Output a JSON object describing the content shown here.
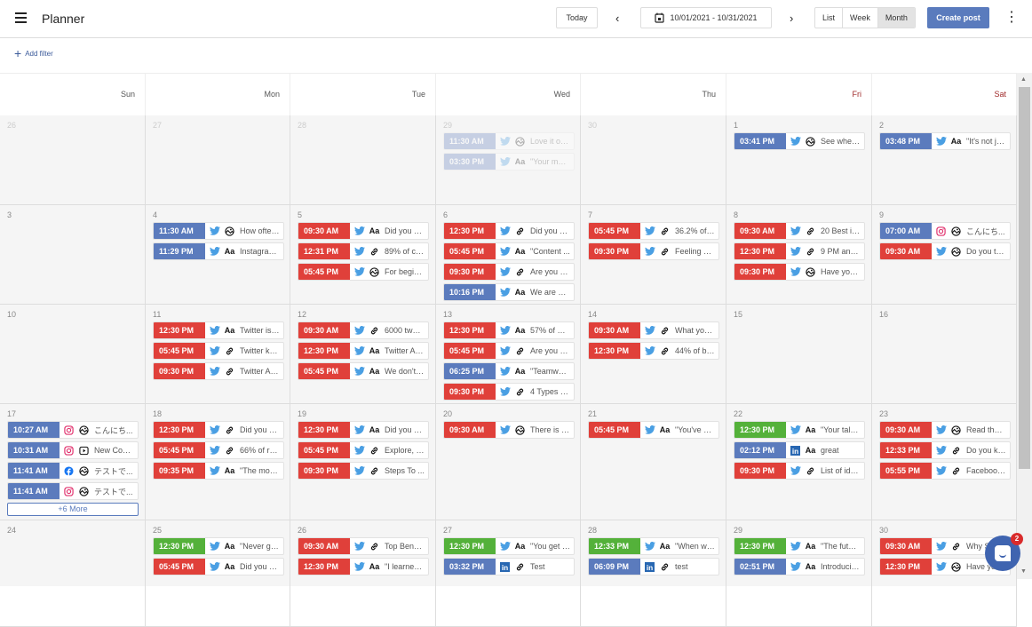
{
  "header": {
    "title": "Planner",
    "today_label": "Today",
    "prev_icon": "chevron-left",
    "next_icon": "chevron-right",
    "date_range": "10/01/2021 - 10/31/2021",
    "views": [
      "List",
      "Week",
      "Month"
    ],
    "active_view": "Month",
    "create_label": "Create post",
    "more_icon": "kebab-vertical"
  },
  "filter": {
    "label": "Add filter"
  },
  "weekdays": [
    "Sun",
    "Mon",
    "Tue",
    "Wed",
    "Thu",
    "Fri",
    "Sat"
  ],
  "colors": {
    "published": "#5b7bbd",
    "failed": "#e0403a",
    "scheduled": "#54b13a"
  },
  "weeks": [
    [
      {
        "day": "26",
        "other": true,
        "posts": []
      },
      {
        "day": "27",
        "other": true,
        "posts": []
      },
      {
        "day": "28",
        "other": true,
        "posts": []
      },
      {
        "day": "29",
        "other": true,
        "posts": [
          {
            "time": "11:30 AM",
            "status": "published",
            "network": "twitter",
            "type": "image",
            "text": "Love it or ..."
          },
          {
            "time": "03:30 PM",
            "status": "published",
            "network": "twitter",
            "type": "text",
            "text": "\"Your mar..."
          }
        ]
      },
      {
        "day": "30",
        "other": true,
        "posts": []
      },
      {
        "day": "1",
        "posts": [
          {
            "time": "03:41 PM",
            "status": "published",
            "network": "twitter",
            "type": "image",
            "text": "See where ..."
          }
        ]
      },
      {
        "day": "2",
        "posts": [
          {
            "time": "03:48 PM",
            "status": "published",
            "network": "twitter",
            "type": "text",
            "text": "\"It's not ju..."
          }
        ]
      }
    ],
    [
      {
        "day": "3",
        "posts": []
      },
      {
        "day": "4",
        "posts": [
          {
            "time": "11:30 AM",
            "status": "published",
            "network": "twitter",
            "type": "image",
            "text": "How often..."
          },
          {
            "time": "11:29 PM",
            "status": "published",
            "network": "twitter",
            "type": "text",
            "text": "Instagram ..."
          }
        ]
      },
      {
        "day": "5",
        "posts": [
          {
            "time": "09:30 AM",
            "status": "failed",
            "network": "twitter",
            "type": "text",
            "text": "Did you kn..."
          },
          {
            "time": "12:31 PM",
            "status": "failed",
            "network": "twitter",
            "type": "link",
            "text": "89% of co..."
          },
          {
            "time": "05:45 PM",
            "status": "failed",
            "network": "twitter",
            "type": "image",
            "text": "For beginn..."
          }
        ]
      },
      {
        "day": "6",
        "posts": [
          {
            "time": "12:30 PM",
            "status": "failed",
            "network": "twitter",
            "type": "link",
            "text": "Did you kn..."
          },
          {
            "time": "05:45 PM",
            "status": "failed",
            "network": "twitter",
            "type": "text",
            "text": "\"Content ..."
          },
          {
            "time": "09:30 PM",
            "status": "failed",
            "network": "twitter",
            "type": "link",
            "text": "Are you str..."
          },
          {
            "time": "10:16 PM",
            "status": "published",
            "network": "twitter",
            "type": "text",
            "text": "We are ho..."
          }
        ]
      },
      {
        "day": "7",
        "posts": [
          {
            "time": "05:45 PM",
            "status": "failed",
            "network": "twitter",
            "type": "link",
            "text": "36.2% of B..."
          },
          {
            "time": "09:30 PM",
            "status": "failed",
            "network": "twitter",
            "type": "link",
            "text": "Feeling stu..."
          }
        ]
      },
      {
        "day": "8",
        "posts": [
          {
            "time": "09:30 AM",
            "status": "failed",
            "network": "twitter",
            "type": "link",
            "text": "20 Best id..."
          },
          {
            "time": "12:30 PM",
            "status": "failed",
            "network": "twitter",
            "type": "link",
            "text": "9 PM and ..."
          },
          {
            "time": "09:30 PM",
            "status": "failed",
            "network": "twitter",
            "type": "image",
            "text": "Have you t..."
          }
        ]
      },
      {
        "day": "9",
        "posts": [
          {
            "time": "07:00 AM",
            "status": "published",
            "network": "instagram",
            "type": "image",
            "text": "こんにち..."
          },
          {
            "time": "09:30 AM",
            "status": "failed",
            "network": "twitter",
            "type": "image",
            "text": "Do you thi..."
          }
        ]
      }
    ],
    [
      {
        "day": "10",
        "posts": []
      },
      {
        "day": "11",
        "posts": [
          {
            "time": "12:30 PM",
            "status": "failed",
            "network": "twitter",
            "type": "text",
            "text": "Twitter is t..."
          },
          {
            "time": "05:45 PM",
            "status": "failed",
            "network": "twitter",
            "type": "link",
            "text": "Twitter ke..."
          },
          {
            "time": "09:30 PM",
            "status": "failed",
            "network": "twitter",
            "type": "link",
            "text": "Twitter Alg..."
          }
        ]
      },
      {
        "day": "12",
        "posts": [
          {
            "time": "09:30 AM",
            "status": "failed",
            "network": "twitter",
            "type": "link",
            "text": "6000 twee..."
          },
          {
            "time": "12:30 PM",
            "status": "failed",
            "network": "twitter",
            "type": "text",
            "text": "Twitter Alg..."
          },
          {
            "time": "05:45 PM",
            "status": "failed",
            "network": "twitter",
            "type": "text",
            "text": "We don't h..."
          }
        ]
      },
      {
        "day": "13",
        "posts": [
          {
            "time": "12:30 PM",
            "status": "failed",
            "network": "twitter",
            "type": "text",
            "text": "57% of ma..."
          },
          {
            "time": "05:45 PM",
            "status": "failed",
            "network": "twitter",
            "type": "link",
            "text": "Are you str..."
          },
          {
            "time": "06:25 PM",
            "status": "published",
            "network": "twitter",
            "type": "text",
            "text": "\"Teamwor..."
          },
          {
            "time": "09:30 PM",
            "status": "failed",
            "network": "twitter",
            "type": "link",
            "text": "4 Types Of..."
          }
        ]
      },
      {
        "day": "14",
        "posts": [
          {
            "time": "09:30 AM",
            "status": "failed",
            "network": "twitter",
            "type": "link",
            "text": "What you ..."
          },
          {
            "time": "12:30 PM",
            "status": "failed",
            "network": "twitter",
            "type": "link",
            "text": "44% of bra..."
          }
        ]
      },
      {
        "day": "15",
        "posts": []
      },
      {
        "day": "16",
        "posts": []
      }
    ],
    [
      {
        "day": "17",
        "more": "+6 More",
        "posts": [
          {
            "time": "10:27 AM",
            "status": "published",
            "network": "instagram",
            "type": "image",
            "text": "こんにち..."
          },
          {
            "time": "10:31 AM",
            "status": "published",
            "network": "instagram",
            "type": "video",
            "text": "New Com..."
          },
          {
            "time": "11:41 AM",
            "status": "published",
            "network": "facebook",
            "type": "image",
            "text": "テストで..."
          },
          {
            "time": "11:41 AM",
            "status": "published",
            "network": "instagram",
            "type": "image",
            "text": "テストで..."
          }
        ]
      },
      {
        "day": "18",
        "posts": [
          {
            "time": "12:30 PM",
            "status": "failed",
            "network": "twitter",
            "type": "link",
            "text": "Did you kn..."
          },
          {
            "time": "05:45 PM",
            "status": "failed",
            "network": "twitter",
            "type": "link",
            "text": "66% of res..."
          },
          {
            "time": "09:35 PM",
            "status": "failed",
            "network": "twitter",
            "type": "text",
            "text": "\"The most ..."
          }
        ]
      },
      {
        "day": "19",
        "posts": [
          {
            "time": "12:30 PM",
            "status": "failed",
            "network": "twitter",
            "type": "text",
            "text": "Did you kn..."
          },
          {
            "time": "05:45 PM",
            "status": "failed",
            "network": "twitter",
            "type": "link",
            "text": "Explore, se..."
          },
          {
            "time": "09:30 PM",
            "status": "failed",
            "network": "twitter",
            "type": "link",
            "text": "Steps To ..."
          }
        ]
      },
      {
        "day": "20",
        "posts": [
          {
            "time": "09:30 AM",
            "status": "failed",
            "network": "twitter",
            "type": "image",
            "text": "There is s..."
          }
        ]
      },
      {
        "day": "21",
        "posts": [
          {
            "time": "05:45 PM",
            "status": "failed",
            "network": "twitter",
            "type": "text",
            "text": "\"You've go..."
          }
        ]
      },
      {
        "day": "22",
        "posts": [
          {
            "time": "12:30 PM",
            "status": "scheduled",
            "network": "twitter",
            "type": "text",
            "text": "\"Your talen..."
          },
          {
            "time": "02:12 PM",
            "status": "published",
            "network": "linkedin",
            "type": "text",
            "text": "great"
          },
          {
            "time": "09:30 PM",
            "status": "failed",
            "network": "twitter",
            "type": "link",
            "text": "List of ide..."
          }
        ]
      },
      {
        "day": "23",
        "posts": [
          {
            "time": "09:30 AM",
            "status": "failed",
            "network": "twitter",
            "type": "image",
            "text": "Read that ..."
          },
          {
            "time": "12:33 PM",
            "status": "failed",
            "network": "twitter",
            "type": "link",
            "text": "Do you kn..."
          },
          {
            "time": "05:55 PM",
            "status": "failed",
            "network": "twitter",
            "type": "link",
            "text": "Facebook ..."
          }
        ]
      }
    ],
    [
      {
        "day": "24",
        "posts": []
      },
      {
        "day": "25",
        "posts": [
          {
            "time": "12:30 PM",
            "status": "scheduled",
            "network": "twitter",
            "type": "text",
            "text": "\"Never giv..."
          },
          {
            "time": "05:45 PM",
            "status": "failed",
            "network": "twitter",
            "type": "text",
            "text": "Did you kn..."
          }
        ]
      },
      {
        "day": "26",
        "posts": [
          {
            "time": "09:30 AM",
            "status": "failed",
            "network": "twitter",
            "type": "link",
            "text": "Top Benefi..."
          },
          {
            "time": "12:30 PM",
            "status": "failed",
            "network": "twitter",
            "type": "text",
            "text": "\"I learned t..."
          }
        ]
      },
      {
        "day": "27",
        "posts": [
          {
            "time": "12:30 PM",
            "status": "scheduled",
            "network": "twitter",
            "type": "text",
            "text": "\"You get to..."
          },
          {
            "time": "03:32 PM",
            "status": "published",
            "network": "linkedin",
            "type": "link",
            "text": "Test"
          }
        ]
      },
      {
        "day": "28",
        "posts": [
          {
            "time": "12:33 PM",
            "status": "scheduled",
            "network": "twitter",
            "type": "text",
            "text": "\"When we ..."
          },
          {
            "time": "06:09 PM",
            "status": "published",
            "network": "linkedin",
            "type": "link",
            "text": "test"
          }
        ]
      },
      {
        "day": "29",
        "posts": [
          {
            "time": "12:30 PM",
            "status": "scheduled",
            "network": "twitter",
            "type": "text",
            "text": "\"The futur..."
          },
          {
            "time": "02:51 PM",
            "status": "published",
            "network": "twitter",
            "type": "text",
            "text": "Introducin..."
          }
        ]
      },
      {
        "day": "30",
        "posts": [
          {
            "time": "09:30 AM",
            "status": "failed",
            "network": "twitter",
            "type": "link",
            "text": "Why S..."
          },
          {
            "time": "12:30 PM",
            "status": "failed",
            "network": "twitter",
            "type": "image",
            "text": "Have you ..."
          }
        ]
      }
    ]
  ],
  "chat": {
    "badge": "2"
  }
}
